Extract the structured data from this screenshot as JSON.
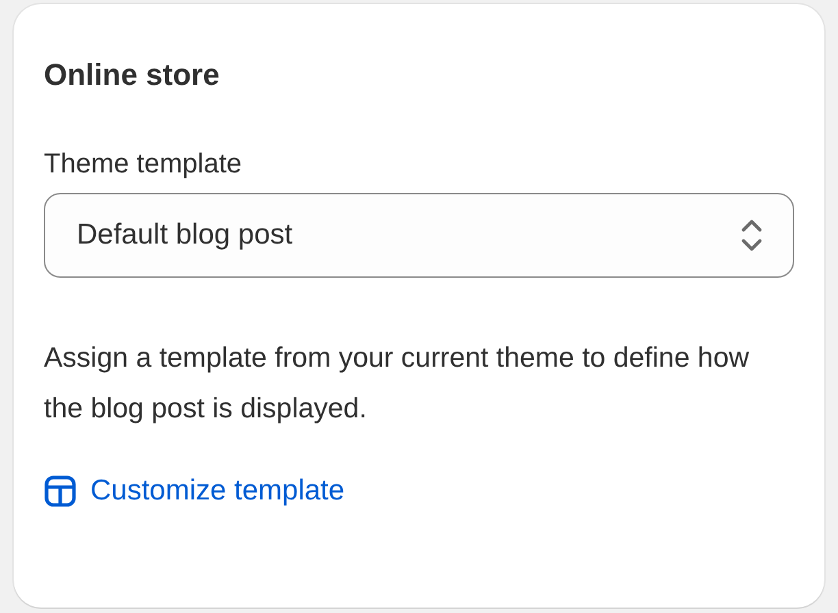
{
  "card": {
    "title": "Online store"
  },
  "theme_template": {
    "label": "Theme template",
    "value": "Default blog post"
  },
  "help_text": "Assign a template from your current theme to define how the blog post is displayed.",
  "link": {
    "label": "Customize template"
  }
}
